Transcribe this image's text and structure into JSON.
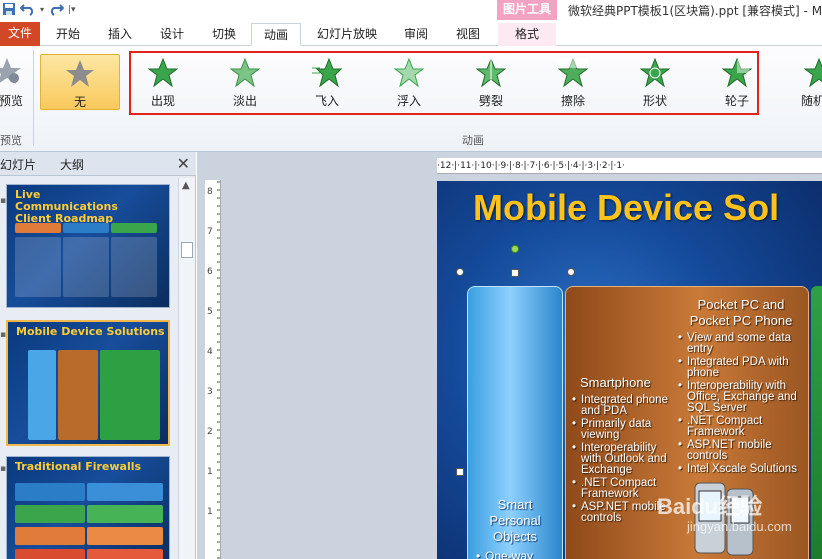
{
  "window": {
    "title": "微软经典PPT模板1(区块篇).ppt [兼容模式] - M",
    "context_tab_group": "图片工具"
  },
  "quick_access": {
    "save_icon": "save-icon",
    "undo_icon": "undo-icon",
    "redo_icon": "redo-icon"
  },
  "tabs": [
    {
      "label": "文件"
    },
    {
      "label": "开始"
    },
    {
      "label": "插入"
    },
    {
      "label": "设计"
    },
    {
      "label": "切换"
    },
    {
      "label": "动画"
    },
    {
      "label": "幻灯片放映"
    },
    {
      "label": "审阅"
    },
    {
      "label": "视图"
    },
    {
      "label": "格式"
    }
  ],
  "active_tab": "动画",
  "ribbon": {
    "preview_label": "预览",
    "preview_group_label": "预览",
    "none_label": "无",
    "effects": [
      {
        "label": "出现"
      },
      {
        "label": "淡出"
      },
      {
        "label": "飞入"
      },
      {
        "label": "浮入"
      },
      {
        "label": "劈裂"
      },
      {
        "label": "擦除"
      },
      {
        "label": "形状"
      },
      {
        "label": "轮子"
      },
      {
        "label": "随机线"
      }
    ],
    "group_label": "动画",
    "highlight_color": "#e2231a"
  },
  "left_pane": {
    "tab_slides": "幻灯片",
    "tab_outline": "大纲",
    "close": "✕",
    "slides": [
      {
        "title": "Live Communications Client Roadmap"
      },
      {
        "title": "Mobile Device Solutions"
      },
      {
        "title": "Traditional Firewalls"
      }
    ]
  },
  "ruler": {
    "horizontal": "·12·|·11·|·10·|·9·|·8·|·7·|·6·|·5·|·4·|·3·|·2·|·1·",
    "vertical": [
      "8",
      "7",
      "6",
      "5",
      "4",
      "3",
      "2",
      "1",
      "1"
    ]
  },
  "slide": {
    "title": "Mobile Device Sol",
    "col1_heading": "Smart Personal Objects",
    "col1_bullets": [
      "One-way"
    ],
    "col2_heading": "Smartphone",
    "col2_bullets": [
      "Integrated phone and PDA",
      "Primarily data viewing",
      "Interoperability with Outlook and Exchange",
      ".NET Compact Framework",
      "ASP.NET mobile controls"
    ],
    "col3_heading": "Pocket PC and Pocket PC Phone",
    "col3_bullets": [
      "View and some data entry",
      "Integrated PDA with phone",
      "Interoperability with Office, Exchange and SQL Server",
      ".NET Compact Framework",
      "ASP.NET mobile controls",
      "Intel Xscale Solutions"
    ]
  },
  "watermark": {
    "logo": "Baidu经验",
    "url": "jingyan.baidu.com"
  },
  "colors": {
    "file_tab": "#d24726",
    "context_tab": "#f2a3c1",
    "slide_title": "#ffc21a",
    "selected_effect": "#f8c95c"
  }
}
